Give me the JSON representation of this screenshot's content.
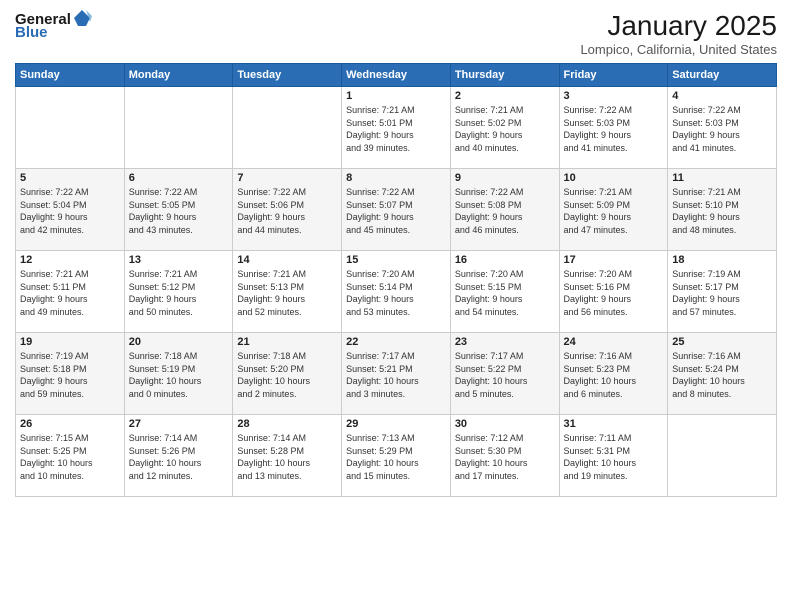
{
  "header": {
    "logo_general": "General",
    "logo_blue": "Blue",
    "month": "January 2025",
    "location": "Lompico, California, United States"
  },
  "days_of_week": [
    "Sunday",
    "Monday",
    "Tuesday",
    "Wednesday",
    "Thursday",
    "Friday",
    "Saturday"
  ],
  "weeks": [
    [
      {
        "day": "",
        "info": ""
      },
      {
        "day": "",
        "info": ""
      },
      {
        "day": "",
        "info": ""
      },
      {
        "day": "1",
        "info": "Sunrise: 7:21 AM\nSunset: 5:01 PM\nDaylight: 9 hours\nand 39 minutes."
      },
      {
        "day": "2",
        "info": "Sunrise: 7:21 AM\nSunset: 5:02 PM\nDaylight: 9 hours\nand 40 minutes."
      },
      {
        "day": "3",
        "info": "Sunrise: 7:22 AM\nSunset: 5:03 PM\nDaylight: 9 hours\nand 41 minutes."
      },
      {
        "day": "4",
        "info": "Sunrise: 7:22 AM\nSunset: 5:03 PM\nDaylight: 9 hours\nand 41 minutes."
      }
    ],
    [
      {
        "day": "5",
        "info": "Sunrise: 7:22 AM\nSunset: 5:04 PM\nDaylight: 9 hours\nand 42 minutes."
      },
      {
        "day": "6",
        "info": "Sunrise: 7:22 AM\nSunset: 5:05 PM\nDaylight: 9 hours\nand 43 minutes."
      },
      {
        "day": "7",
        "info": "Sunrise: 7:22 AM\nSunset: 5:06 PM\nDaylight: 9 hours\nand 44 minutes."
      },
      {
        "day": "8",
        "info": "Sunrise: 7:22 AM\nSunset: 5:07 PM\nDaylight: 9 hours\nand 45 minutes."
      },
      {
        "day": "9",
        "info": "Sunrise: 7:22 AM\nSunset: 5:08 PM\nDaylight: 9 hours\nand 46 minutes."
      },
      {
        "day": "10",
        "info": "Sunrise: 7:21 AM\nSunset: 5:09 PM\nDaylight: 9 hours\nand 47 minutes."
      },
      {
        "day": "11",
        "info": "Sunrise: 7:21 AM\nSunset: 5:10 PM\nDaylight: 9 hours\nand 48 minutes."
      }
    ],
    [
      {
        "day": "12",
        "info": "Sunrise: 7:21 AM\nSunset: 5:11 PM\nDaylight: 9 hours\nand 49 minutes."
      },
      {
        "day": "13",
        "info": "Sunrise: 7:21 AM\nSunset: 5:12 PM\nDaylight: 9 hours\nand 50 minutes."
      },
      {
        "day": "14",
        "info": "Sunrise: 7:21 AM\nSunset: 5:13 PM\nDaylight: 9 hours\nand 52 minutes."
      },
      {
        "day": "15",
        "info": "Sunrise: 7:20 AM\nSunset: 5:14 PM\nDaylight: 9 hours\nand 53 minutes."
      },
      {
        "day": "16",
        "info": "Sunrise: 7:20 AM\nSunset: 5:15 PM\nDaylight: 9 hours\nand 54 minutes."
      },
      {
        "day": "17",
        "info": "Sunrise: 7:20 AM\nSunset: 5:16 PM\nDaylight: 9 hours\nand 56 minutes."
      },
      {
        "day": "18",
        "info": "Sunrise: 7:19 AM\nSunset: 5:17 PM\nDaylight: 9 hours\nand 57 minutes."
      }
    ],
    [
      {
        "day": "19",
        "info": "Sunrise: 7:19 AM\nSunset: 5:18 PM\nDaylight: 9 hours\nand 59 minutes."
      },
      {
        "day": "20",
        "info": "Sunrise: 7:18 AM\nSunset: 5:19 PM\nDaylight: 10 hours\nand 0 minutes."
      },
      {
        "day": "21",
        "info": "Sunrise: 7:18 AM\nSunset: 5:20 PM\nDaylight: 10 hours\nand 2 minutes."
      },
      {
        "day": "22",
        "info": "Sunrise: 7:17 AM\nSunset: 5:21 PM\nDaylight: 10 hours\nand 3 minutes."
      },
      {
        "day": "23",
        "info": "Sunrise: 7:17 AM\nSunset: 5:22 PM\nDaylight: 10 hours\nand 5 minutes."
      },
      {
        "day": "24",
        "info": "Sunrise: 7:16 AM\nSunset: 5:23 PM\nDaylight: 10 hours\nand 6 minutes."
      },
      {
        "day": "25",
        "info": "Sunrise: 7:16 AM\nSunset: 5:24 PM\nDaylight: 10 hours\nand 8 minutes."
      }
    ],
    [
      {
        "day": "26",
        "info": "Sunrise: 7:15 AM\nSunset: 5:25 PM\nDaylight: 10 hours\nand 10 minutes."
      },
      {
        "day": "27",
        "info": "Sunrise: 7:14 AM\nSunset: 5:26 PM\nDaylight: 10 hours\nand 12 minutes."
      },
      {
        "day": "28",
        "info": "Sunrise: 7:14 AM\nSunset: 5:28 PM\nDaylight: 10 hours\nand 13 minutes."
      },
      {
        "day": "29",
        "info": "Sunrise: 7:13 AM\nSunset: 5:29 PM\nDaylight: 10 hours\nand 15 minutes."
      },
      {
        "day": "30",
        "info": "Sunrise: 7:12 AM\nSunset: 5:30 PM\nDaylight: 10 hours\nand 17 minutes."
      },
      {
        "day": "31",
        "info": "Sunrise: 7:11 AM\nSunset: 5:31 PM\nDaylight: 10 hours\nand 19 minutes."
      },
      {
        "day": "",
        "info": ""
      }
    ]
  ]
}
